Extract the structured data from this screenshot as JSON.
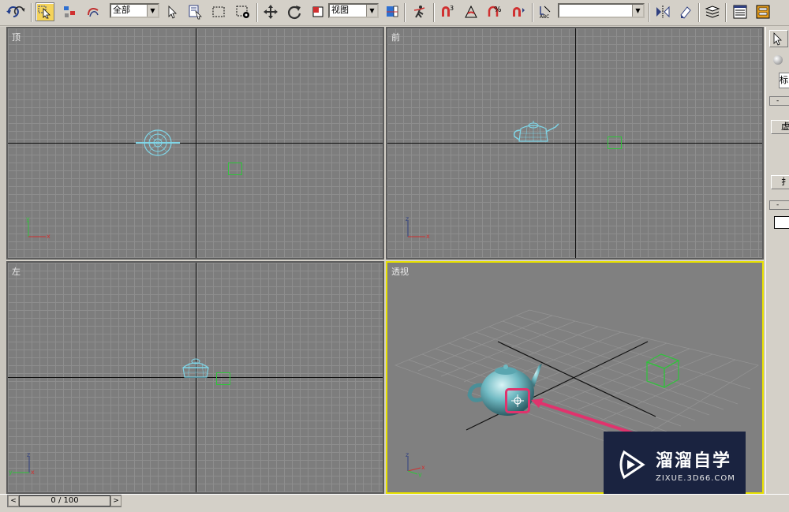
{
  "toolbar": {
    "selection_filter": "全部",
    "reference_coord": "视图",
    "named_selection": ""
  },
  "viewports": {
    "top_label": "顶",
    "front_label": "前",
    "left_label": "左",
    "persp_label": "透视"
  },
  "axis_labels": {
    "x": "x",
    "y": "y",
    "z": "z"
  },
  "right_panel": {
    "tab_text": "标",
    "button1": "虚",
    "button2": "扌"
  },
  "timeline": {
    "frame": "0 / 100"
  },
  "watermark": {
    "title": "溜溜自学",
    "url": "ZIXUE.3D66.COM"
  },
  "colors": {
    "active_border": "#e7e000",
    "highlight_pink": "#e0336d",
    "teapot": "#7fd6e8",
    "dummy_green": "#2fc43a"
  }
}
